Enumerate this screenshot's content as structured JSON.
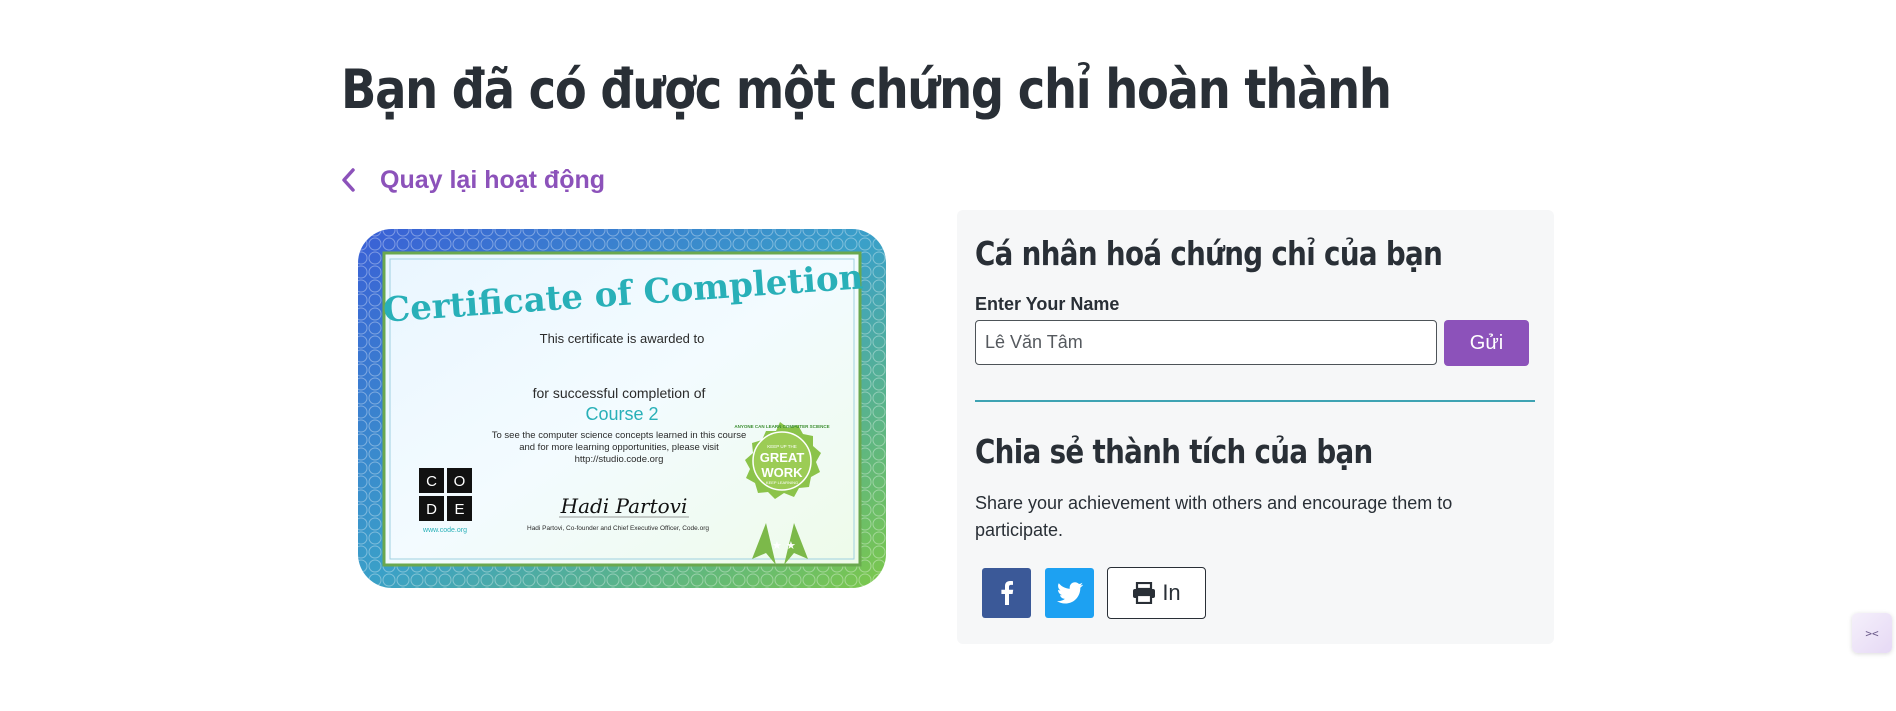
{
  "page": {
    "title": "Bạn đã có được một chứng chỉ hoàn thành"
  },
  "back_link": {
    "label": "Quay lại hoạt động"
  },
  "certificate": {
    "heading": "Certificate of Completion",
    "awarded_to": "This certificate is awarded to",
    "completion": "for successful completion of",
    "course": "Course 2",
    "note_line1": "To see the computer science concepts learned in this course",
    "note_line2": "and for more learning opportunities, please visit",
    "note_line3": "http://studio.code.org",
    "logo_letters": [
      "C",
      "O",
      "D",
      "E"
    ],
    "logo_url": "www.code.org",
    "signature": "Hadi Partovi",
    "signer": "Hadi Partovi, Co-founder and Chief Executive Officer, Code.org",
    "seal_top": "GREAT",
    "seal_bottom": "WORK",
    "seal_ring": "ANYONE CAN LEARN COMPUTER SCIENCE",
    "seal_small_top": "KEEP UP THE",
    "seal_small_bottom": "KEEP LEARNING"
  },
  "personalize": {
    "heading": "Cá nhân hoá chứng chỉ của bạn",
    "label": "Enter Your Name",
    "name_value": "Lê Văn Tâm",
    "submit_label": "Gửi"
  },
  "share": {
    "heading": "Chia sẻ thành tích của bạn",
    "text": "Share your achievement with others and encourage them to participate.",
    "print_label": "In"
  },
  "widget": {
    "label": "><"
  },
  "colors": {
    "accent": "#8c52ba",
    "heading": "#292f36",
    "divider": "#3ea3b3",
    "facebook": "#3b5998",
    "twitter": "#1da1f2"
  }
}
